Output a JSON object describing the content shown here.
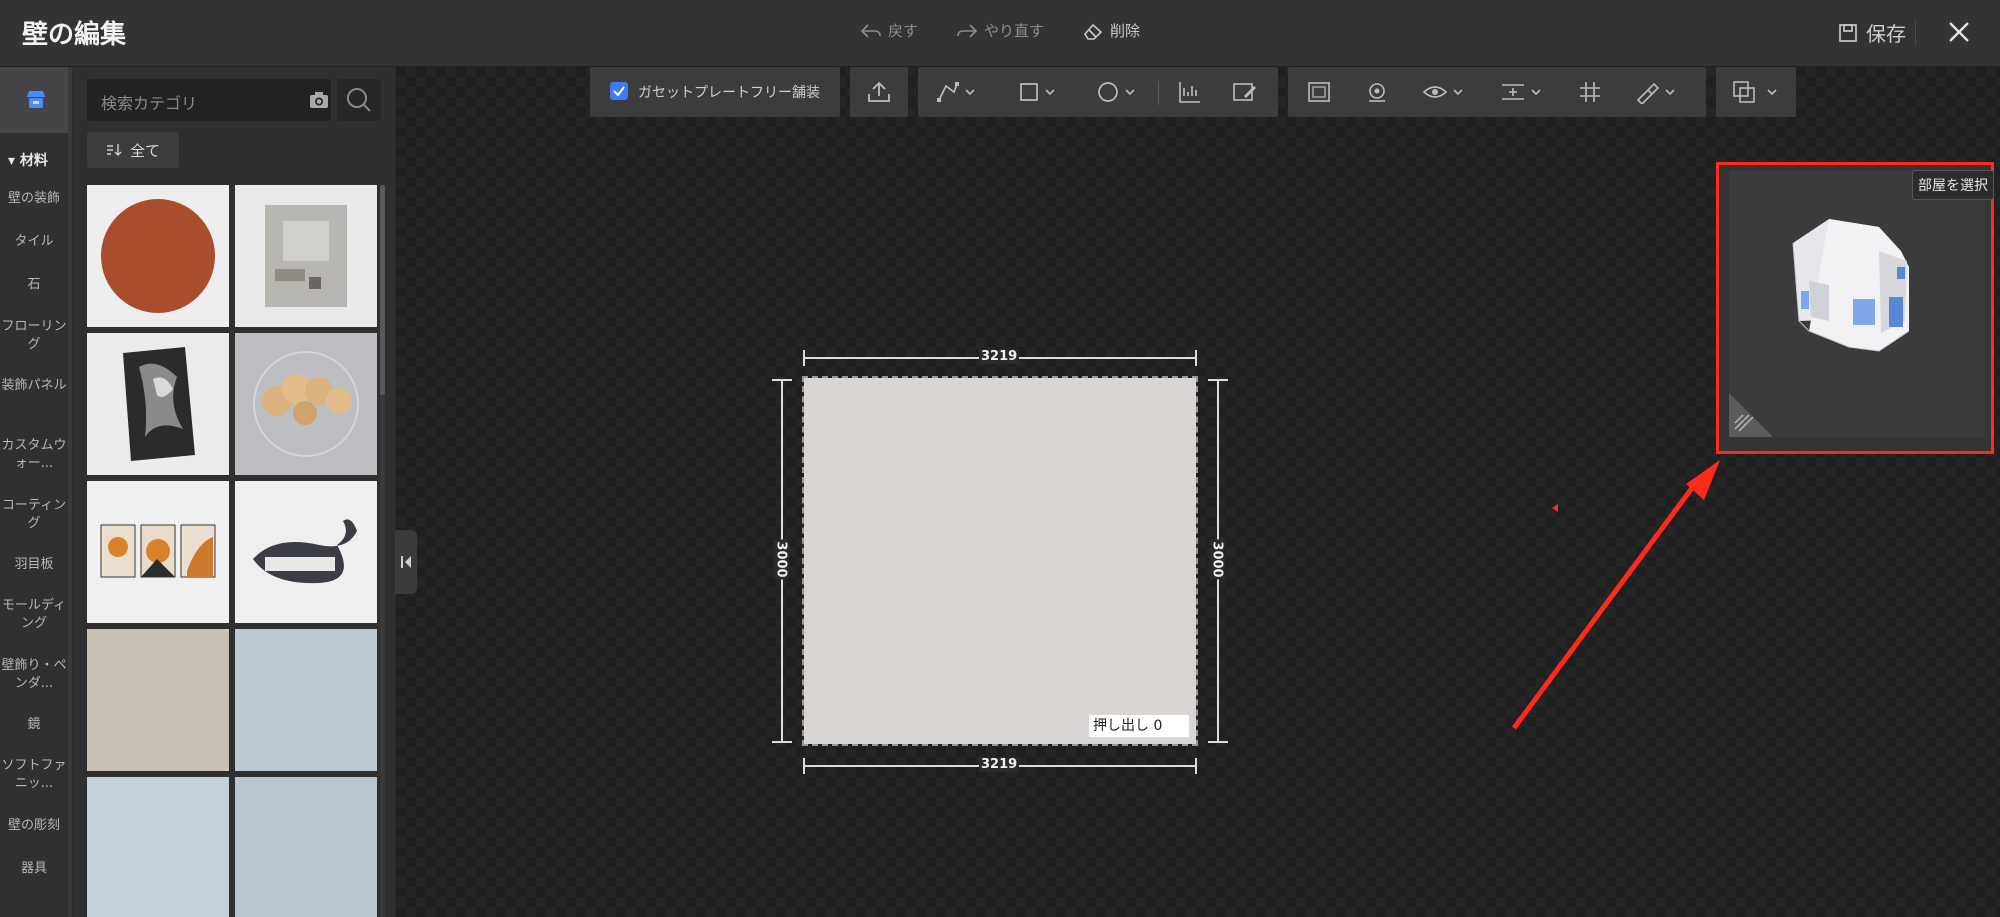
{
  "window": {
    "title": "壁の編集",
    "undo": "戻す",
    "redo": "やり直す",
    "delete": "削除",
    "save": "保存"
  },
  "search": {
    "placeholder": "検索カテゴリ"
  },
  "filter": {
    "label": "全て"
  },
  "sidebar": {
    "section": "材料",
    "items": [
      "壁の装飾",
      "タイル",
      "石",
      "フローリング",
      "装飾パネル",
      "カスタムウォー...",
      "コーティング",
      "羽目板",
      "モールディング",
      "壁飾り・ペンダ...",
      "鏡",
      "ソフトファニッ...",
      "壁の彫刻",
      "器具"
    ]
  },
  "toolbar": {
    "gusset_checkbox": "ガセットプレートフリー舗装",
    "gusset_checked": true
  },
  "canvas": {
    "width_top": "3219",
    "width_bottom": "3219",
    "height_left": "3000",
    "height_right": "3000",
    "extrude_label": "押し出し",
    "extrude_value": "0"
  },
  "preview": {
    "select_room": "部屋を選択"
  },
  "colors": {
    "accent": "#ff2a1a",
    "checkbox": "#3b7cf6",
    "wall": "#d8d5d3"
  }
}
